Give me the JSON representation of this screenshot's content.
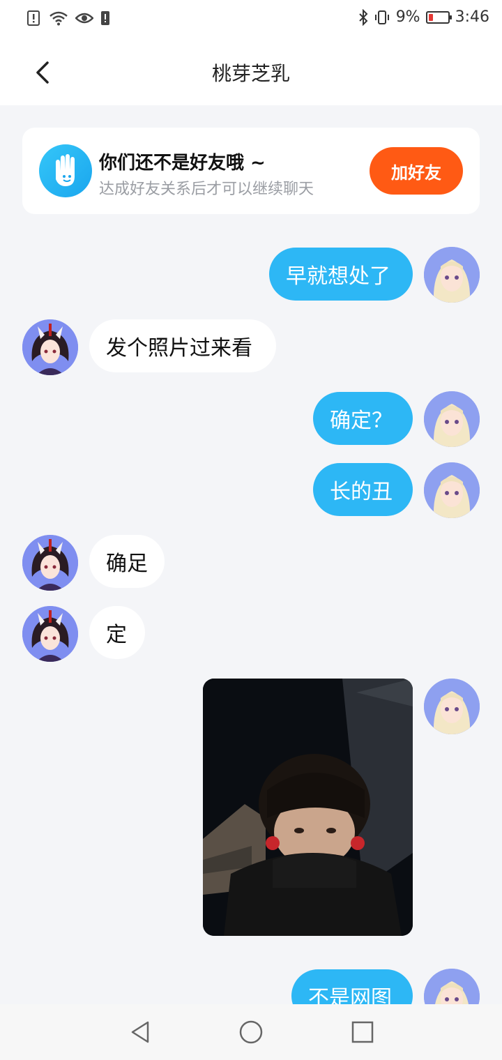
{
  "status_bar": {
    "battery_percent": "9%",
    "time": "3:46",
    "left_icons": [
      "alert-icon",
      "wifi-icon",
      "eye-icon",
      "warning-icon"
    ],
    "right_icons": [
      "bluetooth-icon",
      "vibrate-icon",
      "battery-icon"
    ]
  },
  "header": {
    "title": "桃芽芝乳",
    "back_icon": "chevron-left-icon"
  },
  "notice": {
    "title": "你们还不是好友哦 ~",
    "subtitle": "达成好友关系后才可以继续聊天",
    "button_label": "加好友",
    "icon": "hand-wave-icon"
  },
  "messages": [
    {
      "side": "right",
      "text": "早就想处了"
    },
    {
      "side": "left",
      "text": "发个照片过来看"
    },
    {
      "side": "right",
      "text": "确定？"
    },
    {
      "side": "right",
      "text": "长的丑"
    },
    {
      "side": "left",
      "text": "确足"
    },
    {
      "side": "left",
      "text": "定"
    },
    {
      "side": "right",
      "type": "image",
      "image_desc": "photo"
    },
    {
      "side": "right",
      "text": "不是网图"
    }
  ],
  "nav_bar": {
    "icons": [
      "nav-back-icon",
      "nav-home-icon",
      "nav-recent-icon"
    ]
  },
  "colors": {
    "accent_blue": "#2db7f5",
    "accent_orange": "#ff5a14",
    "background": "#f4f5f8"
  }
}
